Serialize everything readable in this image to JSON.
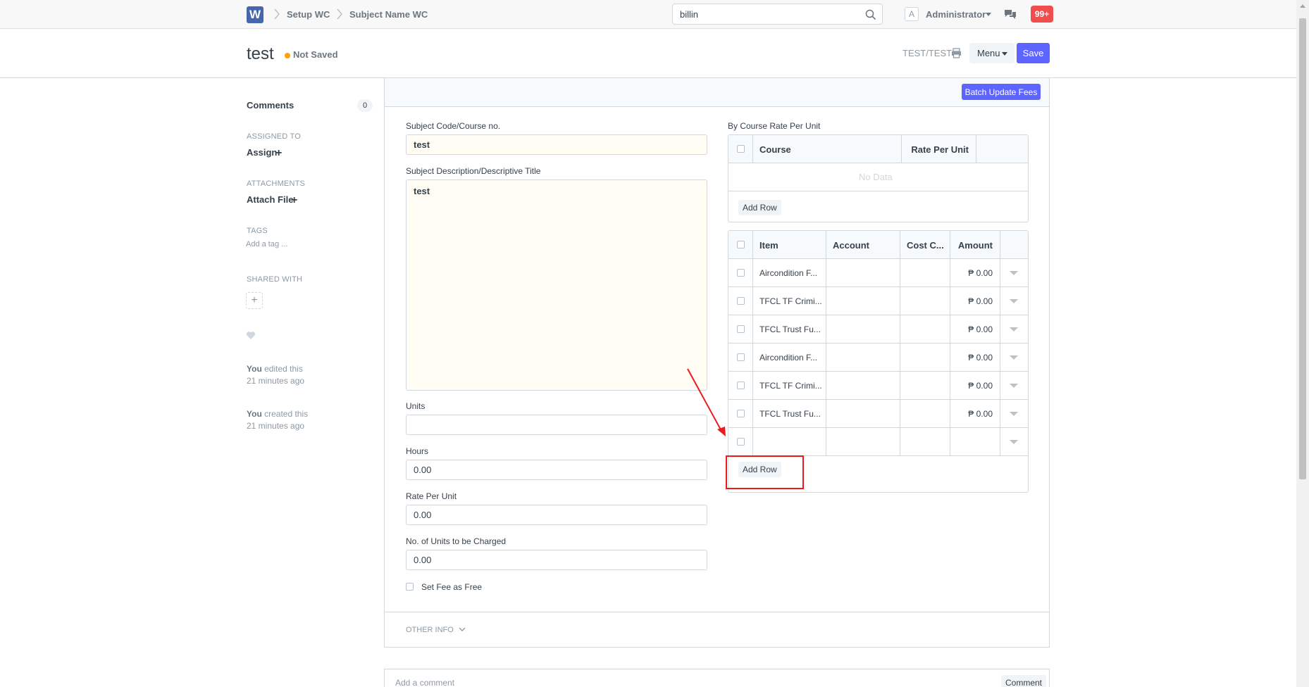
{
  "navbar": {
    "logo_letter": "W",
    "breadcrumbs": [
      "Setup WC",
      "Subject Name WC"
    ],
    "search_value": "billin",
    "avatar_letter": "A",
    "user_name": "Administrator",
    "notification_count": "99+"
  },
  "page_head": {
    "title": "test",
    "status": "Not Saved",
    "doc_id": "TEST/TEST",
    "menu_label": "Menu",
    "save_label": "Save"
  },
  "sidebar": {
    "comments_label": "Comments",
    "comments_count": "0",
    "assigned_to_label": "ASSIGNED TO",
    "assign_label": "Assign",
    "attachments_label": "ATTACHMENTS",
    "attach_label": "Attach File",
    "tags_label": "TAGS",
    "add_tag_label": "Add a tag ...",
    "shared_with_label": "SHARED WITH",
    "timeline": [
      {
        "who": "You",
        "action": " edited this",
        "when": "21 minutes ago"
      },
      {
        "who": "You",
        "action": " created this",
        "when": "21 minutes ago"
      }
    ]
  },
  "form": {
    "batch_update_label": "Batch Update Fees",
    "subject_code_label": "Subject Code/Course no.",
    "subject_code_value": "test",
    "description_label": "Subject Description/Descriptive Title",
    "description_value": "test",
    "units_label": "Units",
    "units_value": "",
    "hours_label": "Hours",
    "hours_value": "0.00",
    "rate_label": "Rate Per Unit",
    "rate_value": "0.00",
    "charged_label": "No. of Units to be Charged",
    "charged_value": "0.00",
    "free_label": "Set Fee as Free",
    "other_info_label": "OTHER INFO"
  },
  "rate_grid": {
    "title": "By Course Rate Per Unit",
    "columns": [
      "Course",
      "Rate Per Unit"
    ],
    "empty_text": "No Data",
    "add_row_label": "Add Row"
  },
  "fees_grid": {
    "columns": [
      "Item",
      "Account",
      "Cost C...",
      "Amount"
    ],
    "rows": [
      {
        "item": "Aircondition F...",
        "account": "",
        "cost_center": "",
        "amount": "₱ 0.00"
      },
      {
        "item": "TFCL TF Crimi...",
        "account": "",
        "cost_center": "",
        "amount": "₱ 0.00"
      },
      {
        "item": "TFCL Trust Fu...",
        "account": "",
        "cost_center": "",
        "amount": "₱ 0.00"
      },
      {
        "item": "Aircondition F...",
        "account": "",
        "cost_center": "",
        "amount": "₱ 0.00"
      },
      {
        "item": "TFCL TF Crimi...",
        "account": "",
        "cost_center": "",
        "amount": "₱ 0.00"
      },
      {
        "item": "TFCL Trust Fu...",
        "account": "",
        "cost_center": "",
        "amount": "₱ 0.00"
      },
      {
        "item": "",
        "account": "",
        "cost_center": "",
        "amount": ""
      }
    ],
    "add_row_label": "Add Row"
  },
  "comment_box": {
    "placeholder": "Add a comment",
    "button_label": "Comment"
  },
  "colors": {
    "primary": "#5e64ff",
    "logo": "#4666ad",
    "annotation": "#e81c1c",
    "notification": "#f04e4e",
    "unsaved_dot": "#ffa00a"
  }
}
